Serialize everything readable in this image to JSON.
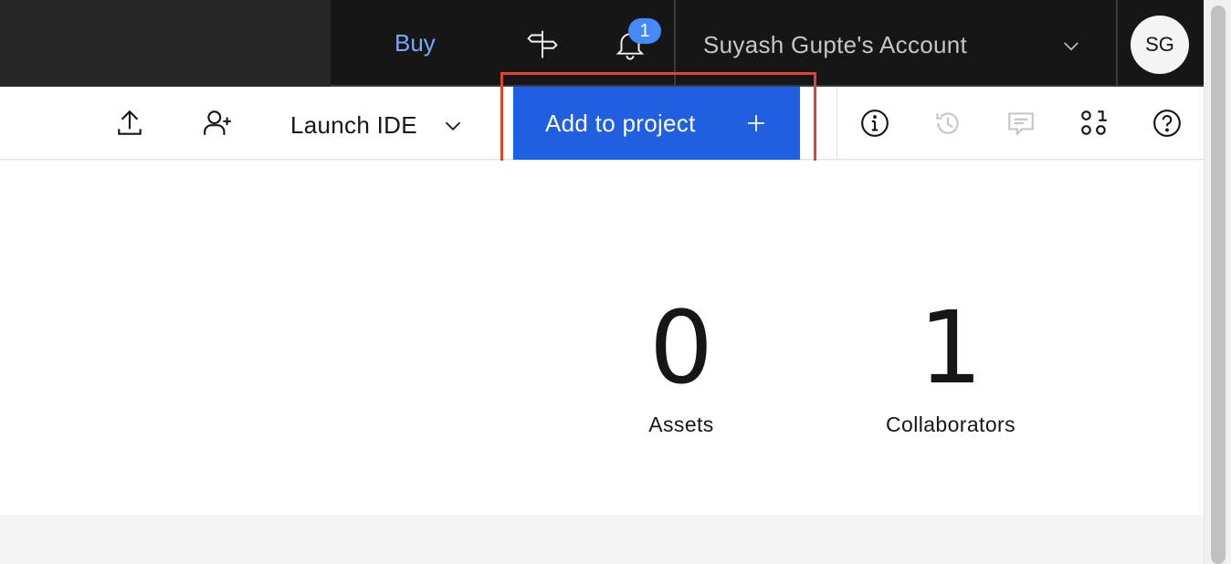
{
  "header": {
    "buy_label": "Buy",
    "notification_count": "1",
    "account_name": "Suyash Gupte's Account",
    "avatar_initials": "SG"
  },
  "toolbar": {
    "launch_ide_label": "Launch IDE",
    "add_to_project_label": "Add to project"
  },
  "stats": [
    {
      "value": "0",
      "label": "Assets"
    },
    {
      "value": "1",
      "label": "Collaborators"
    }
  ],
  "colors": {
    "header_bg": "#161616",
    "primary_button": "#1f5fe0",
    "link_blue": "#78a9ff",
    "highlight_red": "#e0432e"
  }
}
